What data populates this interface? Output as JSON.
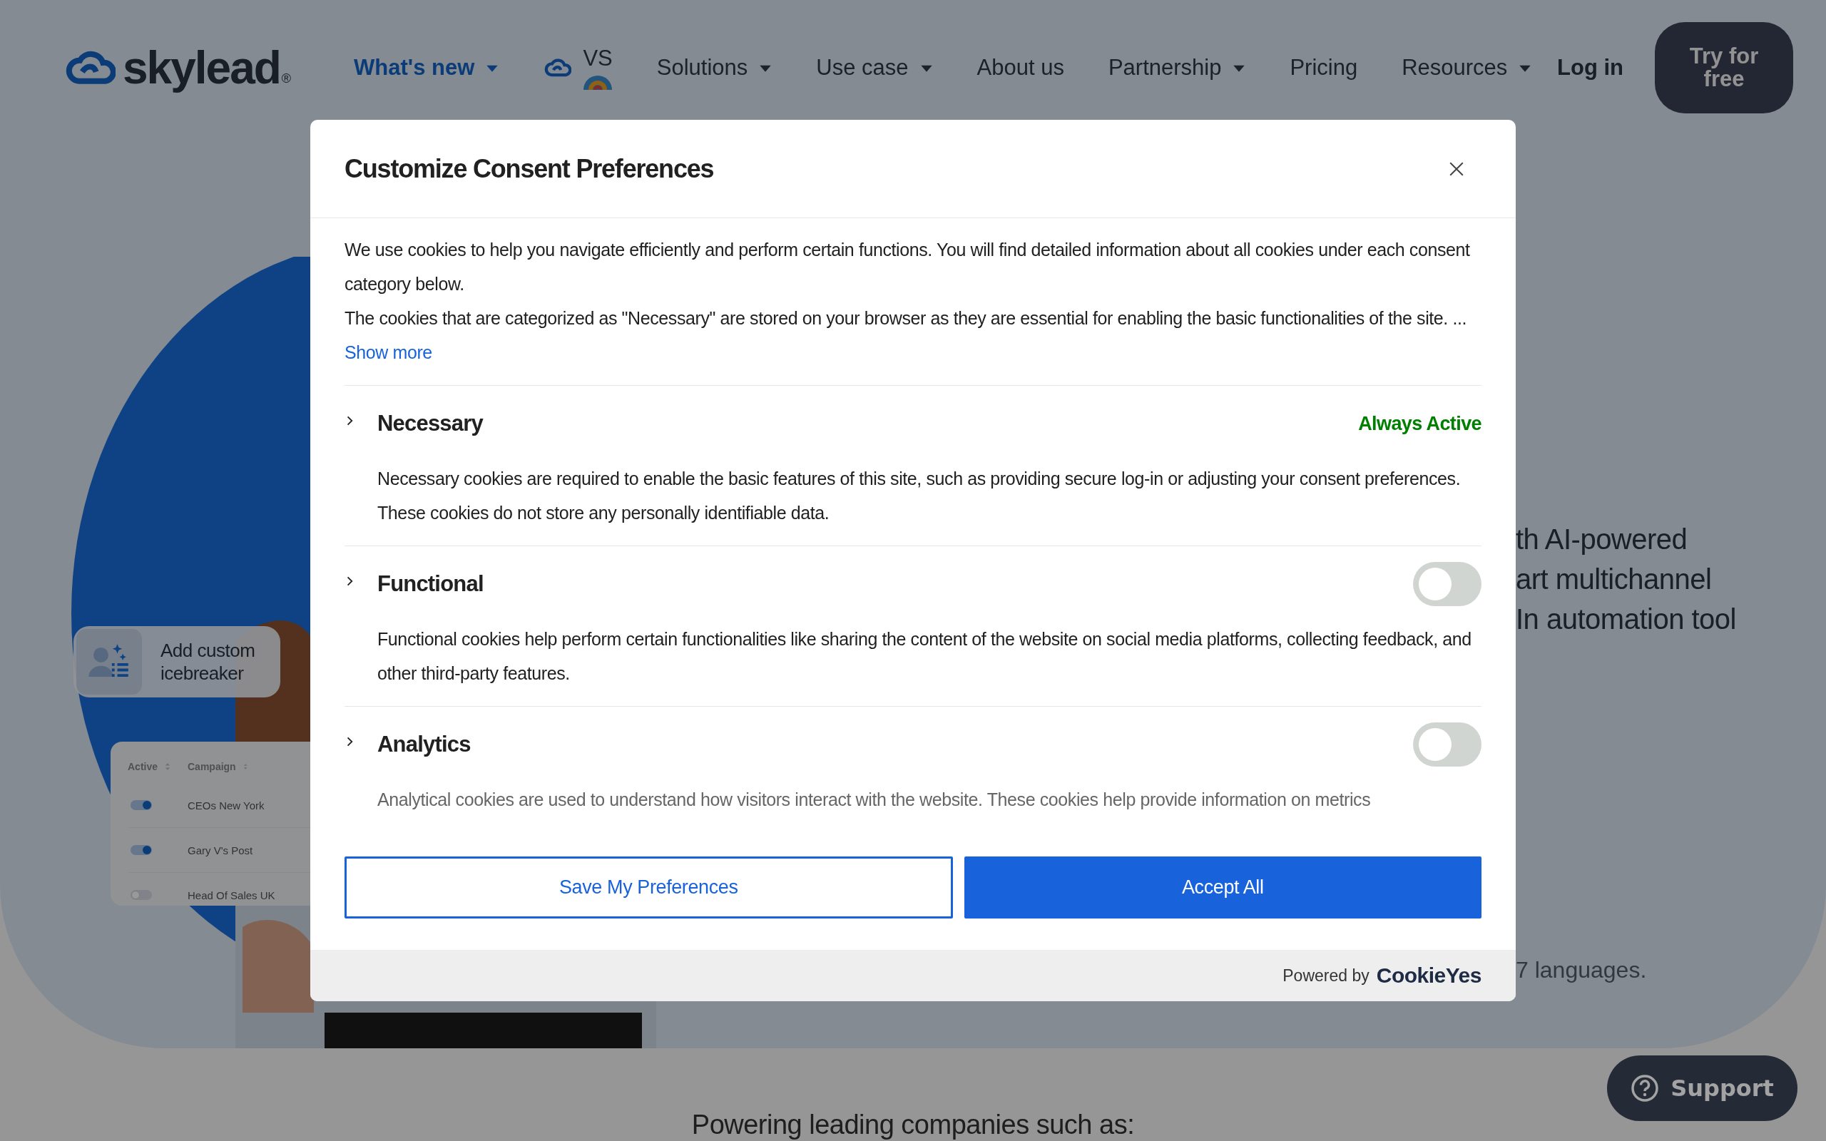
{
  "nav": {
    "logo": "skylead",
    "logo_mark": "®",
    "items": [
      {
        "label": "What's new",
        "kind": "dropdown",
        "highlighted": true
      },
      {
        "label": "VS",
        "kind": "versus",
        "highlighted": false
      },
      {
        "label": "Solutions",
        "kind": "dropdown",
        "highlighted": false
      },
      {
        "label": "Use case",
        "kind": "dropdown",
        "highlighted": false
      },
      {
        "label": "About us",
        "kind": "link",
        "highlighted": false
      },
      {
        "label": "Partnership",
        "kind": "dropdown",
        "highlighted": false
      },
      {
        "label": "Pricing",
        "kind": "link",
        "highlighted": false
      },
      {
        "label": "Resources",
        "kind": "dropdown",
        "highlighted": false
      }
    ],
    "login": "Log in",
    "cta": "Try for free"
  },
  "hero": {
    "lines": [
      "th AI-powered",
      "art multichannel",
      "In automation tool"
    ],
    "note": "7 languages.",
    "icebreaker_card": {
      "label": "Add custom icebreaker"
    },
    "campaign_table": {
      "columns": [
        "Active",
        "Campaign"
      ],
      "rows": [
        {
          "active": true,
          "name": "CEOs New York"
        },
        {
          "active": true,
          "name": "Gary V's Post"
        },
        {
          "active": false,
          "name": "Head Of Sales UK"
        }
      ]
    }
  },
  "logos_heading": "Powering leading companies such as:",
  "consent_modal": {
    "title": "Customize Consent Preferences",
    "intro": [
      "We use cookies to help you navigate efficiently and perform certain functions. You will find detailed information about all cookies under each consent category below.",
      "The cookies that are categorized as \"Necessary\" are stored on your browser as they are essential for enabling the basic functionalities of the site. ..."
    ],
    "show_more": "Show more",
    "categories": [
      {
        "name": "Necessary",
        "kind": "always",
        "status": "Always Active",
        "description": "Necessary cookies are required to enable the basic features of this site, such as providing secure log-in or adjusting your consent preferences. These cookies do not store any personally identifiable data."
      },
      {
        "name": "Functional",
        "kind": "toggle",
        "on": false,
        "description": "Functional cookies help perform certain functionalities like sharing the content of the website on social media platforms, collecting feedback, and other third-party features."
      },
      {
        "name": "Analytics",
        "kind": "toggle",
        "on": false,
        "description": "Analytical cookies are used to understand how visitors interact with the website. These cookies help provide information on metrics"
      }
    ],
    "buttons": [
      {
        "label": "Save My Preferences",
        "kind": "outline"
      },
      {
        "label": "Accept All",
        "kind": "primary"
      }
    ],
    "powered_by": "Powered by",
    "brand": "CookieYes"
  },
  "support_button": "Support"
}
